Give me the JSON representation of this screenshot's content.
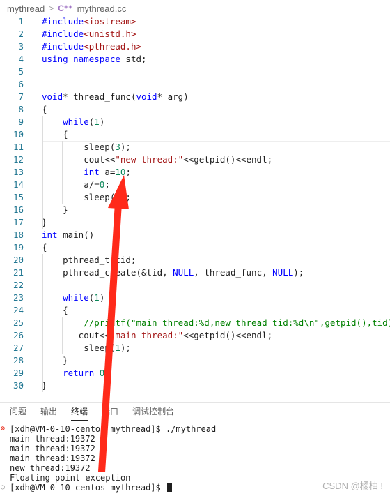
{
  "breadcrumb": {
    "folder": "mythread",
    "separator": ">",
    "file_icon": "C++",
    "file": "mythread.cc"
  },
  "editor": {
    "lines": [
      {
        "n": "1",
        "text": "#include<iostream>"
      },
      {
        "n": "2",
        "text": "#include<unistd.h>"
      },
      {
        "n": "3",
        "text": "#include<pthread.h>"
      },
      {
        "n": "4",
        "text": "using namespace std;"
      },
      {
        "n": "5",
        "text": ""
      },
      {
        "n": "6",
        "text": ""
      },
      {
        "n": "7",
        "text": "void* thread_func(void* arg)"
      },
      {
        "n": "8",
        "text": "{"
      },
      {
        "n": "9",
        "text": "    while(1)"
      },
      {
        "n": "10",
        "text": "    {"
      },
      {
        "n": "11",
        "text": "        sleep(3);"
      },
      {
        "n": "12",
        "text": "        cout<<\"new thread:\"<<getpid()<<endl;"
      },
      {
        "n": "13",
        "text": "        int a=10;"
      },
      {
        "n": "14",
        "text": "        a/=0;"
      },
      {
        "n": "15",
        "text": "        sleep(1);"
      },
      {
        "n": "16",
        "text": "    }"
      },
      {
        "n": "17",
        "text": "}"
      },
      {
        "n": "18",
        "text": "int main()"
      },
      {
        "n": "19",
        "text": "{"
      },
      {
        "n": "20",
        "text": "    pthread_t tid;"
      },
      {
        "n": "21",
        "text": "    pthread_create(&tid, NULL, thread_func, NULL);"
      },
      {
        "n": "22",
        "text": ""
      },
      {
        "n": "23",
        "text": "    while(1)"
      },
      {
        "n": "24",
        "text": "    {"
      },
      {
        "n": "25",
        "text": "        //printf(\"main thread:%d,new thread tid:%d\\n\",getpid(),tid);"
      },
      {
        "n": "26",
        "text": "       cout<<\"main thread:\"<<getpid()<<endl;"
      },
      {
        "n": "27",
        "text": "        sleep(1);"
      },
      {
        "n": "28",
        "text": "    }"
      },
      {
        "n": "29",
        "text": "    return 0;"
      },
      {
        "n": "30",
        "text": "}"
      }
    ]
  },
  "panel": {
    "tabs": [
      "问题",
      "输出",
      "终端",
      "端口",
      "调试控制台"
    ],
    "active_tab": "终端"
  },
  "terminal": {
    "lines": [
      "[xdh@VM-0-10-centos mythread]$ ./mythread",
      "main thread:19372",
      "main thread:19372",
      "main thread:19372",
      "new thread:19372",
      "Floating point exception",
      "[xdh@VM-0-10-centos mythread]$ "
    ],
    "error_marker": "⊗",
    "idle_marker": "○"
  },
  "watermark": "CSDN @橘柚 !",
  "colors": {
    "keyword": "#0000ff",
    "string": "#a31515",
    "number": "#098658",
    "comment": "#008000",
    "preprocessor": "#af00db",
    "line_number": "#237893",
    "arrow": "#ff2a1a"
  }
}
